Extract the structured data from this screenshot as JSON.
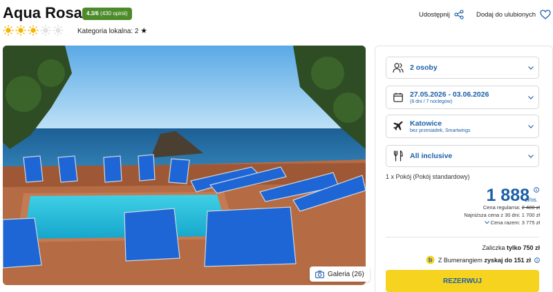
{
  "hotel": {
    "name": "Aqua Rosa",
    "rating": "4.3/6",
    "reviews": "(430 opinii)",
    "stars": 3,
    "stars_max": 5,
    "category_label": "Kategoria lokalna: 2"
  },
  "header": {
    "share_label": "Udostępnij",
    "favorite_label": "Dodaj do ulubionych"
  },
  "gallery": {
    "label": "Galeria (26)"
  },
  "booking": {
    "persons": "2 osoby",
    "dates": "27.05.2026 - 03.06.2026",
    "dates_sub": "(8 dni / 7 noclegów)",
    "departure": "Katowice",
    "departure_sub": "bez przesiadek, Smartwings",
    "board": "All inclusive",
    "room": "1 x Pokój  (Pokój standardowy)",
    "price": "1 888",
    "price_unit": "zł/os.",
    "regular_label": "Cena regularna:",
    "regular_price": "2 480 zł",
    "lowest_30": "Najniższa cena z 30 dni: 1 700 zł",
    "total": "Cena razem: 3 775 zł",
    "deposit_prefix": "Zaliczka",
    "deposit_value": "tylko 750 zł",
    "bumerang_prefix": "Z Bumerangiem",
    "bumerang_value": "zyskaj do 151 zł",
    "book_label": "REZERWUJ"
  },
  "colors": {
    "accent": "#1c5fa8",
    "rating_bg": "#4c8a2a",
    "button": "#f5d31f",
    "sun": "#f5b400"
  }
}
